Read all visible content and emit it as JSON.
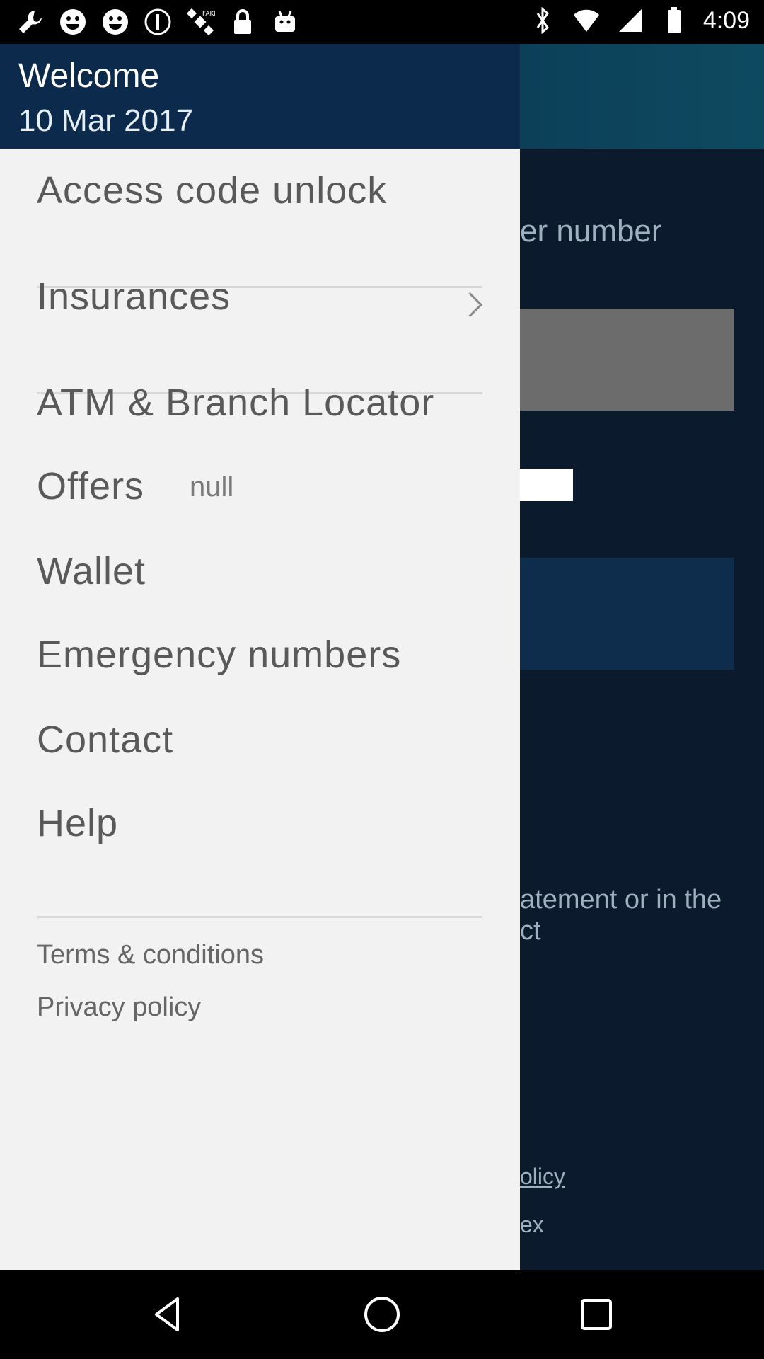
{
  "status_bar": {
    "time": "4:09",
    "left_icons": [
      "wrench-icon",
      "smiley-icon",
      "smiley-icon",
      "info-circle-icon",
      "satellite-icon",
      "lock-icon",
      "android-icon"
    ],
    "right_icons": [
      "bluetooth-icon",
      "wifi-icon",
      "cellular-icon",
      "battery-icon"
    ]
  },
  "background": {
    "field_label_partial": "er number",
    "statement_partial_1": "atement or in the",
    "statement_partial_2": "ct",
    "policy_link_partial": "olicy",
    "footer_partial": "ex"
  },
  "drawer": {
    "welcome": "Welcome",
    "date": "10 Mar 2017",
    "items": [
      {
        "label": "Access code unlock"
      },
      {
        "label": "Insurances"
      },
      {
        "label": "ATM & Branch Locator"
      },
      {
        "label": "Offers",
        "extra": "null"
      },
      {
        "label": "Wallet"
      },
      {
        "label": "Emergency numbers"
      },
      {
        "label": "Contact"
      },
      {
        "label": "Help"
      }
    ],
    "links": [
      "Terms & conditions",
      "Privacy policy"
    ]
  },
  "colors": {
    "drawer_header": "#0c2a4b",
    "drawer_bg": "#f2f2f2",
    "screen_bg": "#0b1a2d",
    "menu_text": "#595959"
  },
  "nav_bar": {
    "buttons": [
      "back-icon",
      "home-icon",
      "recents-icon"
    ]
  }
}
